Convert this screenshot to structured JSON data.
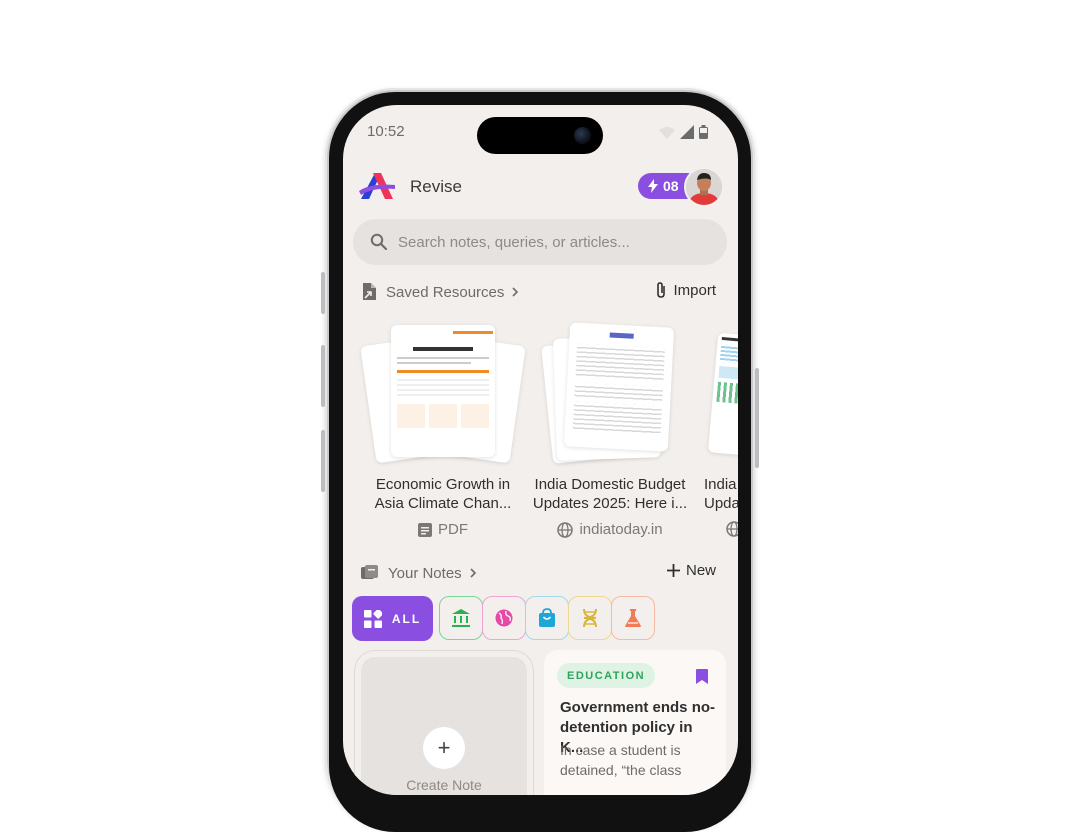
{
  "status_bar": {
    "time": "10:52"
  },
  "app": {
    "title": "Revise",
    "streak_count": "08",
    "accent": "#8a4fe0"
  },
  "search": {
    "placeholder": "Search notes, queries, or articles..."
  },
  "saved_resources": {
    "title": "Saved Resources",
    "action": "Import",
    "items": [
      {
        "title_line1": "Economic Growth in",
        "title_line2": "Asia Climate Chan...",
        "source": "PDF",
        "source_icon": "document-icon"
      },
      {
        "title_line1": "India Domestic Budget",
        "title_line2": "Updates 2025: Here i...",
        "source": "indiatoday.in",
        "source_icon": "globe-icon"
      },
      {
        "title_line1": "India",
        "title_line2": "Upda",
        "source": "",
        "source_icon": "globe-icon"
      }
    ]
  },
  "notes": {
    "title": "Your Notes",
    "action": "New",
    "filters": [
      {
        "label": "ALL",
        "icon": "grid-icon",
        "active": true
      },
      {
        "icon": "bank-icon",
        "color": "#25b24f"
      },
      {
        "icon": "globe-icon",
        "color": "#e64aa8"
      },
      {
        "icon": "shopping-bag-icon",
        "color": "#1ea7d6"
      },
      {
        "icon": "dna-icon",
        "color": "#d9b63a"
      },
      {
        "icon": "flask-icon",
        "color": "#ef7b57"
      }
    ],
    "create_label": "Create Note",
    "cards": [
      {
        "tag": "EDUCATION",
        "title": "Government ends no-detention policy in K...",
        "body": "In case a student is detained, “the class"
      }
    ]
  }
}
